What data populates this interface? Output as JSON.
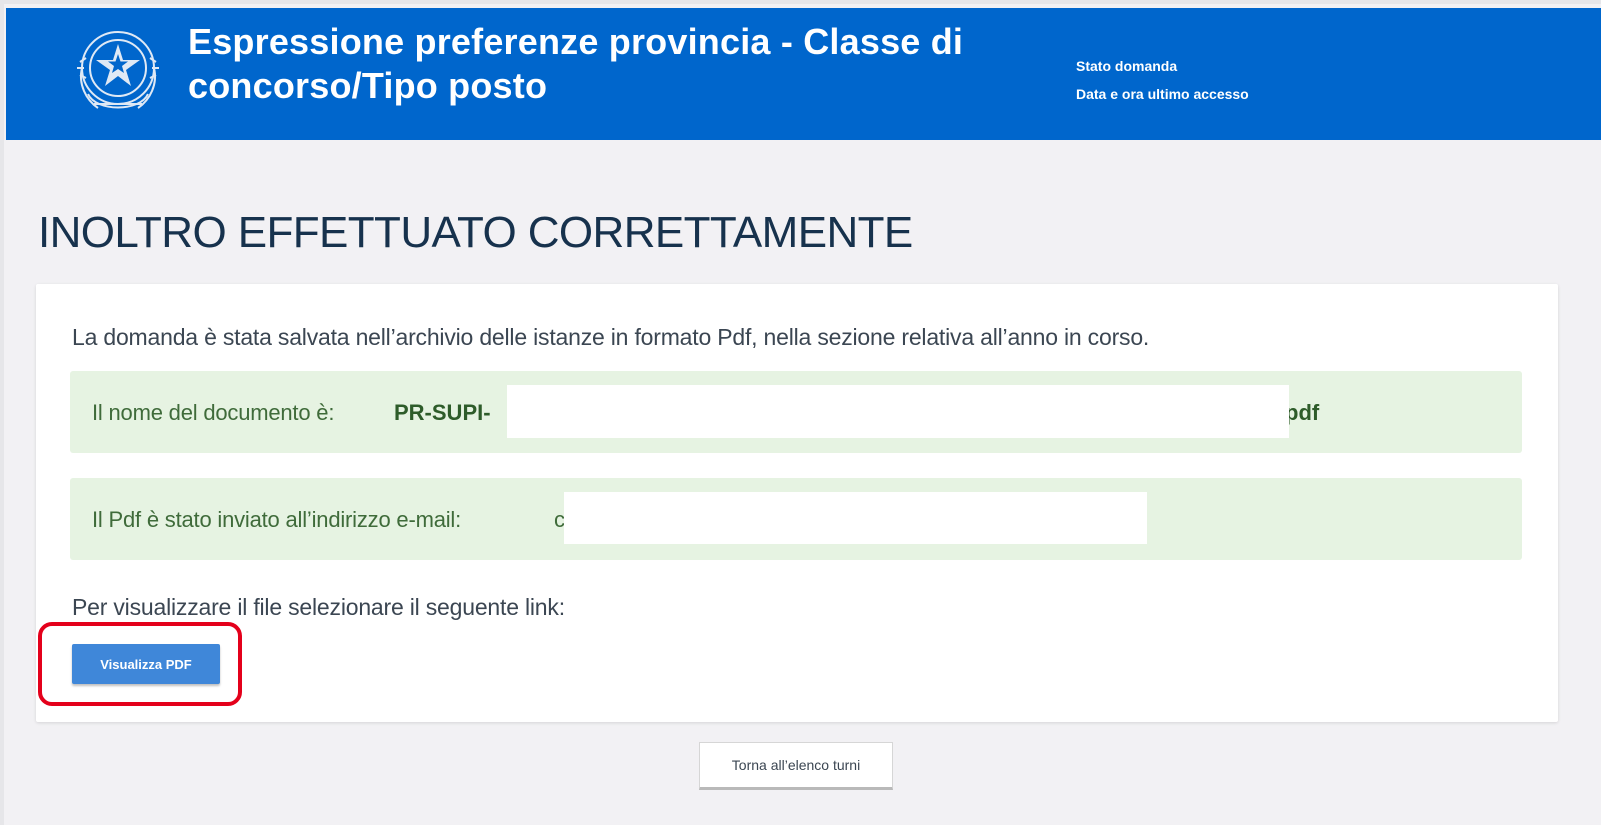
{
  "header": {
    "title": "Espressione preferenze provincia - Classe di concorso/Tipo posto",
    "status_label": "Stato domanda",
    "last_access_label": "Data e ora ultimo accesso",
    "emblem_icon": "italian-republic-emblem-icon",
    "background_color": "#0066cc"
  },
  "page": {
    "heading": "INOLTRO EFFETTUATO CORRETTAMENTE"
  },
  "card": {
    "info_text": "La domanda è stata salvata nell’archivio delle istanze in formato Pdf, nella sezione relativa all’anno in corso.",
    "document_notice": {
      "label": "Il nome del documento è:",
      "name_prefix": "PR-SUPI-",
      "name_suffix": "pdf"
    },
    "email_notice": {
      "label": "Il Pdf è stato inviato all’indirizzo e-mail:",
      "visible_fragment": "c"
    },
    "link_hint": "Per visualizzare il file selezionare il seguente link:",
    "view_pdf_button": "Visualizza PDF"
  },
  "footer": {
    "back_button": "Torna all’elenco turni"
  },
  "colors": {
    "notice_background": "#e6f3e2",
    "highlight": "#e4001b",
    "primary_button": "#3f87d9"
  }
}
